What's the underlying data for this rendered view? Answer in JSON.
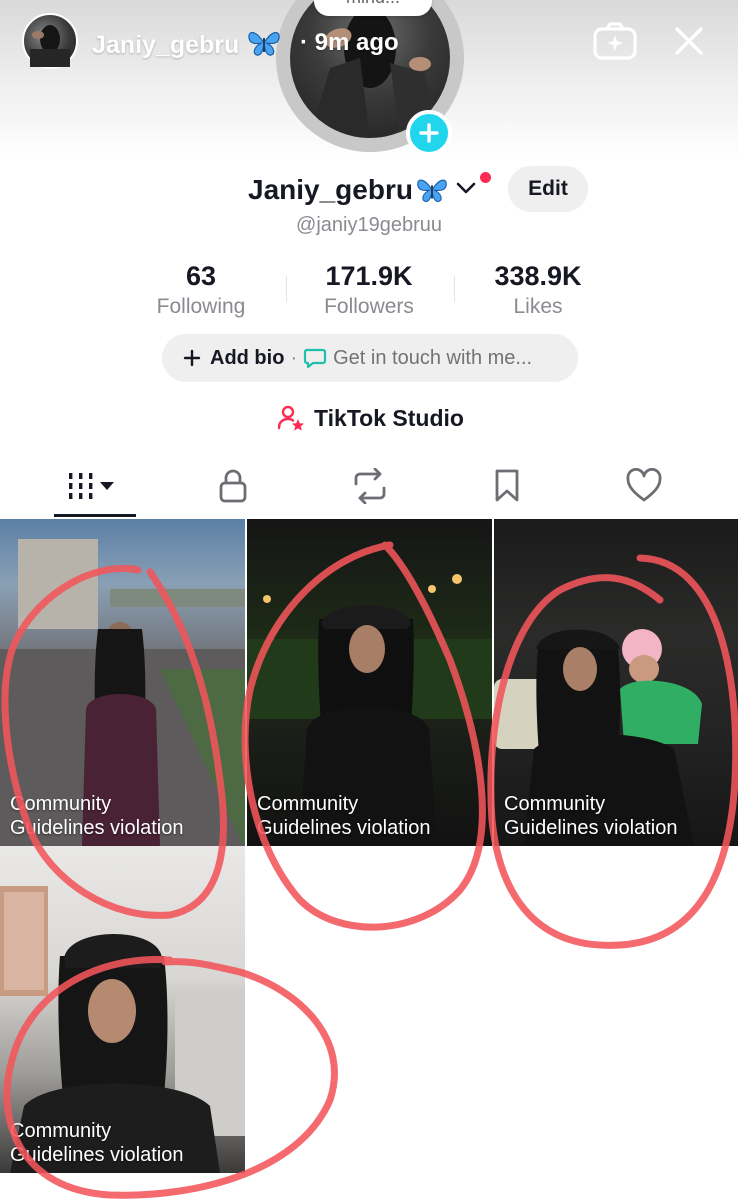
{
  "story": {
    "username": "Janiy_gebru",
    "time": "· 9m ago"
  },
  "profile": {
    "note": "mind...",
    "display_name": "Janiy_gebru",
    "edit_label": "Edit",
    "handle": "@janiy19gebruu"
  },
  "stats": [
    {
      "value": "63",
      "label": "Following"
    },
    {
      "value": "171.9K",
      "label": "Followers"
    },
    {
      "value": "338.9K",
      "label": "Likes"
    }
  ],
  "bio": {
    "add_label": "Add bio",
    "separator": "·",
    "touch_label": "Get in touch with me..."
  },
  "studio": {
    "label": "TikTok Studio"
  },
  "tabs": [
    {
      "icon": "grid-icon",
      "active": true
    },
    {
      "icon": "lock-icon",
      "active": false
    },
    {
      "icon": "repost-icon",
      "active": false
    },
    {
      "icon": "bookmark-icon",
      "active": false
    },
    {
      "icon": "heart-icon",
      "active": false
    }
  ],
  "videos": [
    {
      "caption_line1": "Community",
      "caption_line2": "Guidelines violation"
    },
    {
      "caption_line1": "Community",
      "caption_line2": "Guidelines violation"
    },
    {
      "caption_line1": "Community",
      "caption_line2": "Guidelines violation"
    },
    {
      "caption_line1": "Community",
      "caption_line2": "Guidelines violation"
    }
  ],
  "colors": {
    "accent_cyan": "#20d5ec",
    "accent_red": "#fe2c55",
    "annotation_red": "#f2555a",
    "text_primary": "#161823",
    "text_secondary": "#8a8b91"
  }
}
